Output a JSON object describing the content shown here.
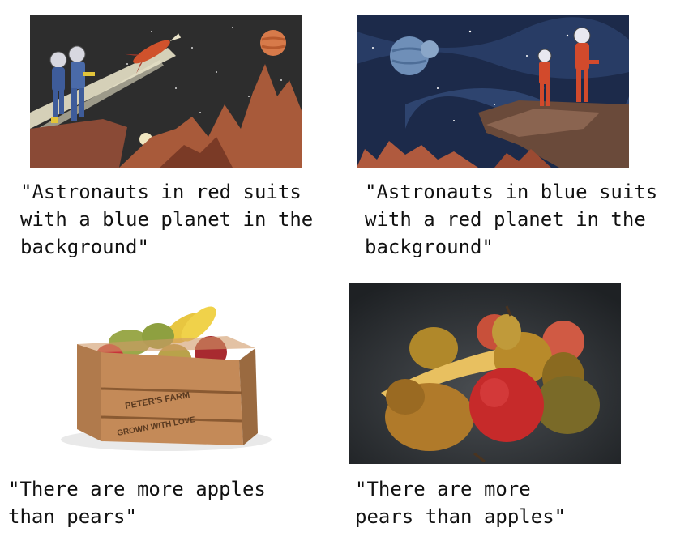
{
  "captions": {
    "top_left": "\"Astronauts in red suits\nwith a blue planet in the\nbackground\"",
    "top_right": "\"Astronauts in blue suits\nwith a red planet in the\nbackground\"",
    "bottom_left": "\"There are more apples\nthan pears\"",
    "bottom_right": "\"There are more\npears than apples\""
  },
  "crate": {
    "brand": "PETER'S FARM",
    "tagline": "GROWN WITH LOVE"
  },
  "colors": {
    "space_dark": "#2b2b2b",
    "space_blue": "#1c2a4a",
    "rocks": "#a0523a",
    "suit_red": "#d24a2c",
    "suit_blue": "#3e5c9a",
    "planet_orange": "#d77a4a",
    "planet_blue": "#6f8fb8"
  }
}
